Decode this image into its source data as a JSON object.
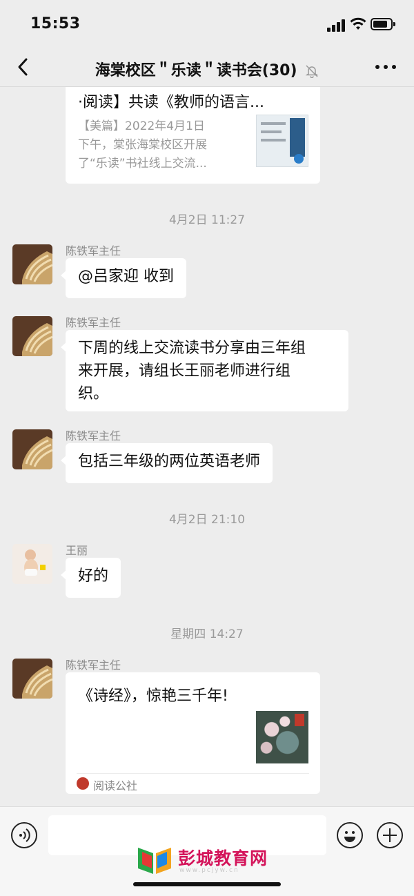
{
  "status_bar": {
    "time": "15:53"
  },
  "nav": {
    "title": "海棠校区＂乐读＂读书会(30)"
  },
  "shared_article": {
    "title": "·阅读】共读《教师的语言...",
    "desc_line1": "【美篇】2022年4月1日",
    "desc_line2": "下午，棠张海棠校区开展",
    "desc_line3": "了“乐读”书社线上交流..."
  },
  "messages": [
    {
      "timestamp": "4月2日 11:27",
      "sender": "陈铁军主任",
      "text": "@吕家迎 收到"
    },
    {
      "sender": "陈铁军主任",
      "lines": [
        "下周的线上交流读书分享由三年组",
        "来开展，请组长王丽老师进行组",
        "织。"
      ]
    },
    {
      "sender": "陈铁军主任",
      "text": "包括三年级的两位英语老师"
    },
    {
      "timestamp": "4月2日 21:10",
      "sender": "王丽",
      "text": "好的"
    },
    {
      "timestamp": "星期四 14:27",
      "sender": "陈铁军主任",
      "title": "《诗经》，惊艳三千年!",
      "source": "阅读公社"
    }
  ],
  "watermark": {
    "name": "彭城教育网",
    "url": "www.pcjyw.cn"
  },
  "colors": {
    "background": "#ededed",
    "bubble": "#ffffff",
    "timestamp": "#9a9a9a",
    "watermark": "#d4145a"
  }
}
